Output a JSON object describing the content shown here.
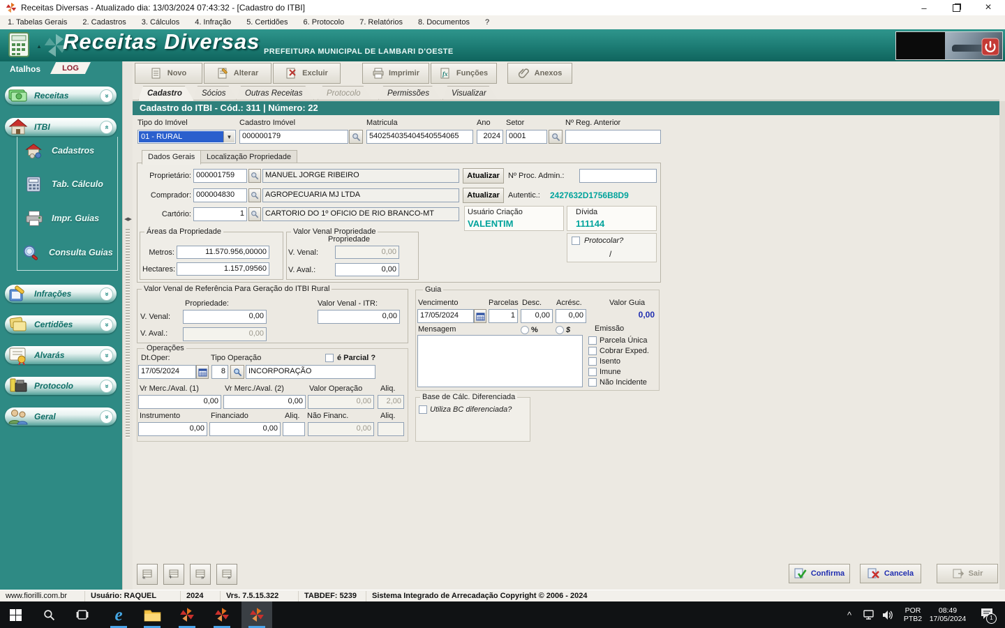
{
  "colors": {
    "teal_header": "#1C7B73",
    "teal_sidebar": "#2E8A84",
    "teal_band": "#2E807B",
    "teal_value_text": "#00A39C",
    "navy_value_text": "#1F2DB0",
    "selection_blue": "#2A5FCD",
    "taskbar_accent": "#4AA3E8",
    "log_text": "#8B1A2B"
  },
  "icons": {
    "app": "fiorilli-pinwheel",
    "calculator": "calculator",
    "search": "magnifier",
    "calendar": "calendar-grid",
    "confirm": "green-check",
    "cancel": "red-x",
    "power": "red-power-button"
  },
  "window": {
    "title": "Receitas Diversas - Atualizado dia: 13/03/2024 07:43:32 - [Cadastro do ITBI]",
    "minimize": "–",
    "close": "×"
  },
  "menubar": {
    "items": [
      "1. Tabelas Gerais",
      "2. Cadastros",
      "3. Cálculos",
      "4. Infração",
      "5. Certidões",
      "6. Protocolo",
      "7. Relatórios",
      "8. Documentos",
      "?"
    ]
  },
  "header": {
    "title": "Receitas Diversas",
    "subtitle": "PREFEITURA MUNICIPAL DE LAMBARI D'OESTE"
  },
  "sidebar": {
    "atalhos": "Atalhos",
    "log": "LOG",
    "receitas": "Receitas",
    "itbi": "ITBI",
    "itbi_items": [
      "Cadastros",
      "Tab. Cálculo",
      "Impr. Guias",
      "Consulta Guias"
    ],
    "groups": [
      "Infrações",
      "Certidões",
      "Alvarás",
      "Protocolo",
      "Geral"
    ]
  },
  "toolbar": {
    "novo": "Novo",
    "alterar": "Alterar",
    "excluir": "Excluir",
    "imprimir": "Imprimir",
    "funcoes": "Funções",
    "anexos": "Anexos"
  },
  "tabs": {
    "cadastro": "Cadastro",
    "socios": "Sócios",
    "outras": "Outras Receitas",
    "protocolo": "Protocolo",
    "permissoes": "Permissões",
    "visualizar": "Visualizar"
  },
  "record_header": "Cadastro do ITBI - Cód.: 311  |  Número:  22",
  "form": {
    "row1": {
      "tipo_label": "Tipo do Imóvel",
      "tipo_value": "01 - RURAL",
      "cad_label": "Cadastro Imóvel",
      "cad_value": "000000179",
      "mat_label": "Matricula",
      "mat_value": "540254035404540554065",
      "ano_label": "Ano",
      "ano_value": "2024",
      "setor_label": "Setor",
      "setor_value": "0001",
      "reg_label": "Nº Reg. Anterior",
      "reg_value": ""
    },
    "inner_tabs": {
      "dados": "Dados Gerais",
      "local": "Localização Propriedade"
    },
    "proprietario": {
      "label": "Proprietário:",
      "code": "000001759",
      "name": "MANUEL JORGE RIBEIRO"
    },
    "comprador": {
      "label": "Comprador:",
      "code": "000004830",
      "name": "AGROPECUARIA MJ LTDA"
    },
    "cartorio": {
      "label": "Cartório:",
      "code": "1",
      "name": "CARTORIO DO 1º OFICIO DE RIO BRANCO-MT"
    },
    "atualizar": "Atualizar",
    "proc_admin": {
      "label": "Nº Proc. Admin.:",
      "value": ""
    },
    "autentic": {
      "label": "Autentic.:",
      "value": "2427632D1756B8D9"
    },
    "usuario_criacao": {
      "label": "Usuário Criação",
      "value": "VALENTIM"
    },
    "divida": {
      "label": "Dívida",
      "value": "111144"
    },
    "areas": {
      "title": "Áreas da Propriedade",
      "metros_label": "Metros:",
      "metros": "11.570.956,00000",
      "hectares_label": "Hectares:",
      "hectares": "1.157,09560"
    },
    "valor_venal_prop": {
      "title": "Valor Venal Propriedade",
      "sub": "Propriedade",
      "v_venal_label": "V. Venal:",
      "v_venal": "0,00",
      "v_aval_label": "V. Aval.:",
      "v_aval": "0,00"
    },
    "protocolar": {
      "label": "Protocolar?",
      "slash": "/"
    },
    "referencia": {
      "title": "Valor Venal de Referência Para Geração do ITBI Rural",
      "propriedade_label": "Propriedade:",
      "itr_label": "Valor Venal - ITR:",
      "v_venal_label": "V. Venal:",
      "v_venal": "0,00",
      "itr_value": "0,00",
      "v_aval_label": "V. Aval.:",
      "v_aval": "0,00"
    },
    "operacoes": {
      "title": "Operações",
      "dt_oper_label": "Dt.Oper:",
      "dt_oper": "17/05/2024",
      "tipo_operacao_label": "Tipo Operação",
      "tipo_codigo": "8",
      "tipo_nome": "INCORPORAÇÃO",
      "parcial_label": "é Parcial ?",
      "vr1_label": "Vr Merc./Aval. (1)",
      "vr1": "0,00",
      "vr2_label": "Vr Merc./Aval. (2)",
      "vr2": "0,00",
      "valor_op_label": "Valor Operação",
      "valor_op": "0,00",
      "aliq1_label": "Aliq.",
      "aliq1": "2,00",
      "instrumento_label": "Instrumento",
      "instrumento": "0,00",
      "financiado_label": "Financiado",
      "financiado": "0,00",
      "aliq2_label": "Aliq.",
      "aliq2": "",
      "nao_financ_label": "Não Financ.",
      "nao_financ": "0,00",
      "aliq3_label": "Aliq.",
      "aliq3": ""
    },
    "guia": {
      "title": "Guia",
      "vencimento_label": "Vencimento",
      "vencimento": "17/05/2024",
      "parcelas_label": "Parcelas",
      "parcelas": "1",
      "desc_label": "Desc.",
      "desc": "0,00",
      "acresc_label": "Acrésc.",
      "acresc": "0,00",
      "valor_guia_label": "Valor Guia",
      "valor_guia": "0,00",
      "mensagem_label": "Mensagem",
      "pct": "%",
      "dollar": "$",
      "emissao_label": "Emissão",
      "emissao_opts": [
        "Parcela Única",
        "Cobrar Exped.",
        "Isento",
        "Imune",
        "Não Incidente"
      ]
    },
    "base_calc": {
      "title": "Base de Cálc. Diferenciada",
      "check_label": "Utiliza BC diferenciada?"
    }
  },
  "footer": {
    "confirma": "Confirma",
    "cancela": "Cancela",
    "sair": "Sair"
  },
  "statusbar": {
    "site": "www.fiorilli.com.br",
    "usuario": "Usuário: RAQUEL",
    "ano": "2024",
    "versao": "Vrs. 7.5.15.322",
    "tabdef": "TABDEF: 5239",
    "copyright": "Sistema Integrado de Arrecadação Copyright © 2006 - 2024"
  },
  "taskbar": {
    "lang1": "POR",
    "lang2": "PTB2",
    "time": "08:49",
    "date": "17/05/2024",
    "badge": "1",
    "tray_chevron": "^"
  }
}
